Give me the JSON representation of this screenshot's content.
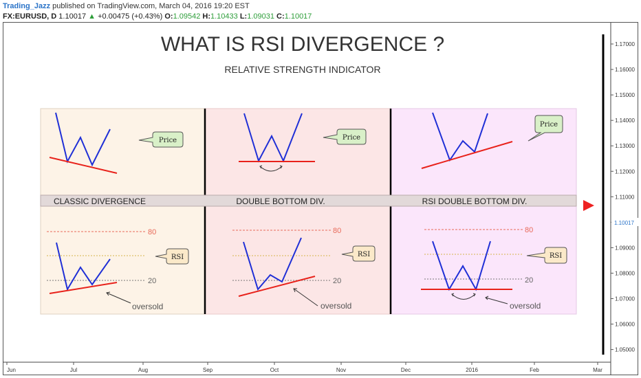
{
  "header": {
    "author": "Trading_Jazz",
    "published": "published on TradingView.com, March 04, 2016 19:20 EST",
    "symbol": "FX:EURUSD, D",
    "last": "1.10017",
    "change_arrow": "▲",
    "change": "+0.00475 (+0.43%)",
    "o_label": "O:",
    "o_value": "1.09542",
    "h_label": "H:",
    "h_value": "1.10433",
    "l_label": "L:",
    "l_value": "1.09031",
    "c_label": "C:",
    "c_value": "1.10017"
  },
  "title": "WHAT IS RSI DIVERGENCE ?",
  "subtitle": "RELATIVE STRENGTH INDICATOR",
  "panels": [
    {
      "label": "CLASSIC DIVERGENCE",
      "price_label": "Price",
      "rsi_label": "RSI",
      "level_high": "80",
      "level_low": "20",
      "note": "oversold"
    },
    {
      "label": "DOUBLE BOTTOM DIV.",
      "price_label": "Price",
      "rsi_label": "RSI",
      "level_high": "80",
      "level_low": "20",
      "note": "oversold"
    },
    {
      "label": "RSI DOUBLE BOTTOM DIV.",
      "price_label": "Price",
      "rsi_label": "RSI",
      "level_high": "80",
      "level_low": "20",
      "note": "oversold"
    }
  ],
  "price_axis": {
    "ticks": [
      "1.17000",
      "1.16000",
      "1.15000",
      "1.14000",
      "1.13000",
      "1.12000",
      "1.11000",
      "1.10000",
      "1.09000",
      "1.08000",
      "1.07000",
      "1.06000",
      "1.05000"
    ],
    "current": "1.10017"
  },
  "time_axis": {
    "ticks": [
      "Jun",
      "Jul",
      "Aug",
      "Sep",
      "Oct",
      "Nov",
      "Dec",
      "2016",
      "Feb",
      "Mar"
    ]
  },
  "colors": {
    "panel1": "#fdf3e7",
    "panel2": "#fce6e6",
    "panel3": "#fbe6fb",
    "band": "#e2d9d9",
    "line_blue": "#1f2fd6",
    "line_red": "#e8211a",
    "level80": "#e86a5a",
    "callout_price": "#d9f0c8",
    "callout_rsi": "#fbe9c9",
    "marker": "#ee2222",
    "current_price": "#2a73c8"
  },
  "icons": {
    "marker": "triangle-right-icon"
  }
}
